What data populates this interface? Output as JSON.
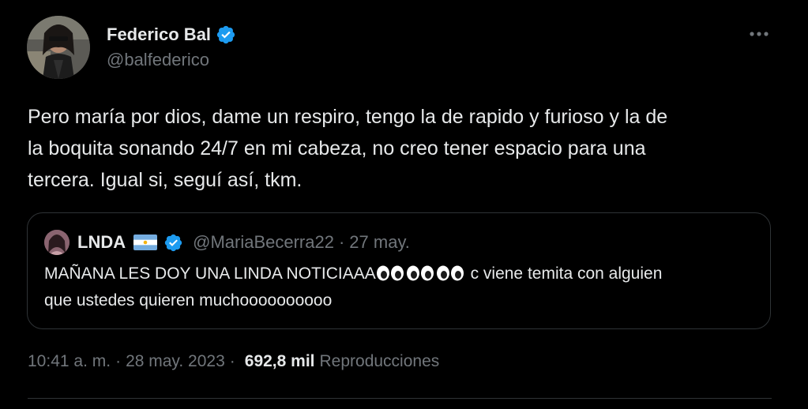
{
  "tweet": {
    "author": {
      "name": "Federico Bal",
      "handle": "@balfederico",
      "avatar_icon": "user-avatar-photo",
      "verified_icon": "verified-badge-icon"
    },
    "text_line_1": "Pero maría por dios, dame un respiro, tengo la de rapido y furioso y la de",
    "text_line_2": "la boquita sonando 24/7 en mi cabeza, no creo tener espacio para una",
    "text_line_3": "tercera. Igual si, seguí así, tkm.",
    "more_icon": "more-horizontal-icon"
  },
  "quote": {
    "name": "LNDA",
    "handle": "@MariaBecerra22",
    "dot": "·",
    "date": "27 may.",
    "flag_icon": "argentina-flag-emoji",
    "text_part_1": "MAÑANA LES DOY UNA LINDA NOTICIAAA",
    "text_part_2": " c viene temita con alguien",
    "text_line_2": "que ustedes quieren muchoooooooooo",
    "emoji_icon": "eyes-emoji"
  },
  "meta": {
    "time": "10:41 a. m.",
    "sep1": "·",
    "date": "28 may. 2023",
    "sep2": "·",
    "views_count": "692,8 mil",
    "views_label": "Reproducciones"
  },
  "colors": {
    "background": "#000000",
    "text": "#e7e9ea",
    "secondary": "#71767b",
    "border": "#2f3336",
    "verified": "#1d9bf0"
  }
}
